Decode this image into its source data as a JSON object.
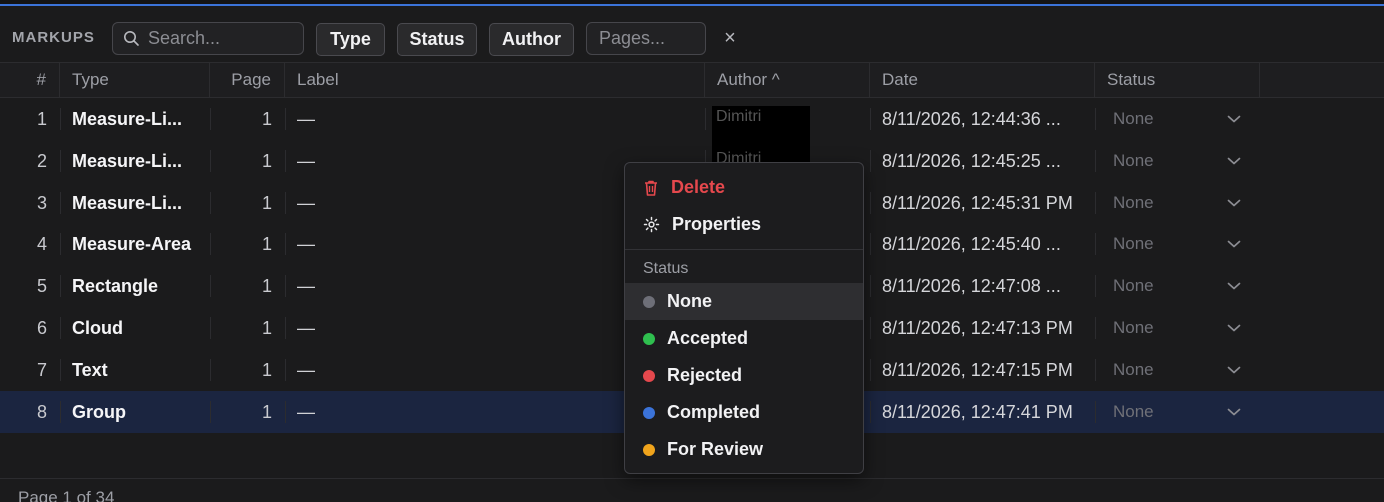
{
  "app": {
    "panel_title": "MARKUPS",
    "accent_color": "#3b73d9"
  },
  "toolbar": {
    "search_placeholder": "Search...",
    "filters": [
      "Type",
      "Status",
      "Author"
    ],
    "pages_placeholder": "Pages...",
    "clear_icon": "close-icon",
    "clear_glyph": "×"
  },
  "table": {
    "columns": [
      "#",
      "Type",
      "Page",
      "Label",
      "Author ^",
      "Date",
      "Status"
    ],
    "author_sort_glyph": "^",
    "rows": [
      {
        "num": "1",
        "type": "Measure-Li...",
        "page": "1",
        "label": "—",
        "author": "Dimitri",
        "date": "8/11/2026, 12:44:36 ...",
        "status": "None"
      },
      {
        "num": "2",
        "type": "Measure-Li...",
        "page": "1",
        "label": "—",
        "author": "Dimitri",
        "date": "8/11/2026, 12:45:25 ...",
        "status": "None"
      },
      {
        "num": "3",
        "type": "Measure-Li...",
        "page": "1",
        "label": "—",
        "author": "",
        "date": "8/11/2026, 12:45:31 PM",
        "status": "None"
      },
      {
        "num": "4",
        "type": "Measure-Area",
        "page": "1",
        "label": "—",
        "author": "",
        "date": "8/11/2026, 12:45:40 ...",
        "status": "None"
      },
      {
        "num": "5",
        "type": "Rectangle",
        "page": "1",
        "label": "—",
        "author": "",
        "date": "8/11/2026, 12:47:08 ...",
        "status": "None"
      },
      {
        "num": "6",
        "type": "Cloud",
        "page": "1",
        "label": "—",
        "author": "",
        "date": "8/11/2026, 12:47:13 PM",
        "status": "None"
      },
      {
        "num": "7",
        "type": "Text",
        "page": "1",
        "label": "—",
        "author": "",
        "date": "8/11/2026, 12:47:15 PM",
        "status": "None"
      },
      {
        "num": "8",
        "type": "Group",
        "page": "1",
        "label": "—",
        "author": "",
        "date": "8/11/2026, 12:47:41 PM",
        "status": "None",
        "selected": true
      }
    ]
  },
  "context_menu": {
    "delete_label": "Delete",
    "delete_color": "#e5484d",
    "properties_label": "Properties",
    "status_header": "Status",
    "status_options": [
      {
        "label": "None",
        "color": "#6e6f78",
        "highlighted": true
      },
      {
        "label": "Accepted",
        "color": "#2fbf4f"
      },
      {
        "label": "Rejected",
        "color": "#e5484d"
      },
      {
        "label": "Completed",
        "color": "#3b73d9"
      },
      {
        "label": "For Review",
        "color": "#f0a41c"
      }
    ]
  },
  "footer": {
    "pagination": "Page 1 of 34"
  }
}
